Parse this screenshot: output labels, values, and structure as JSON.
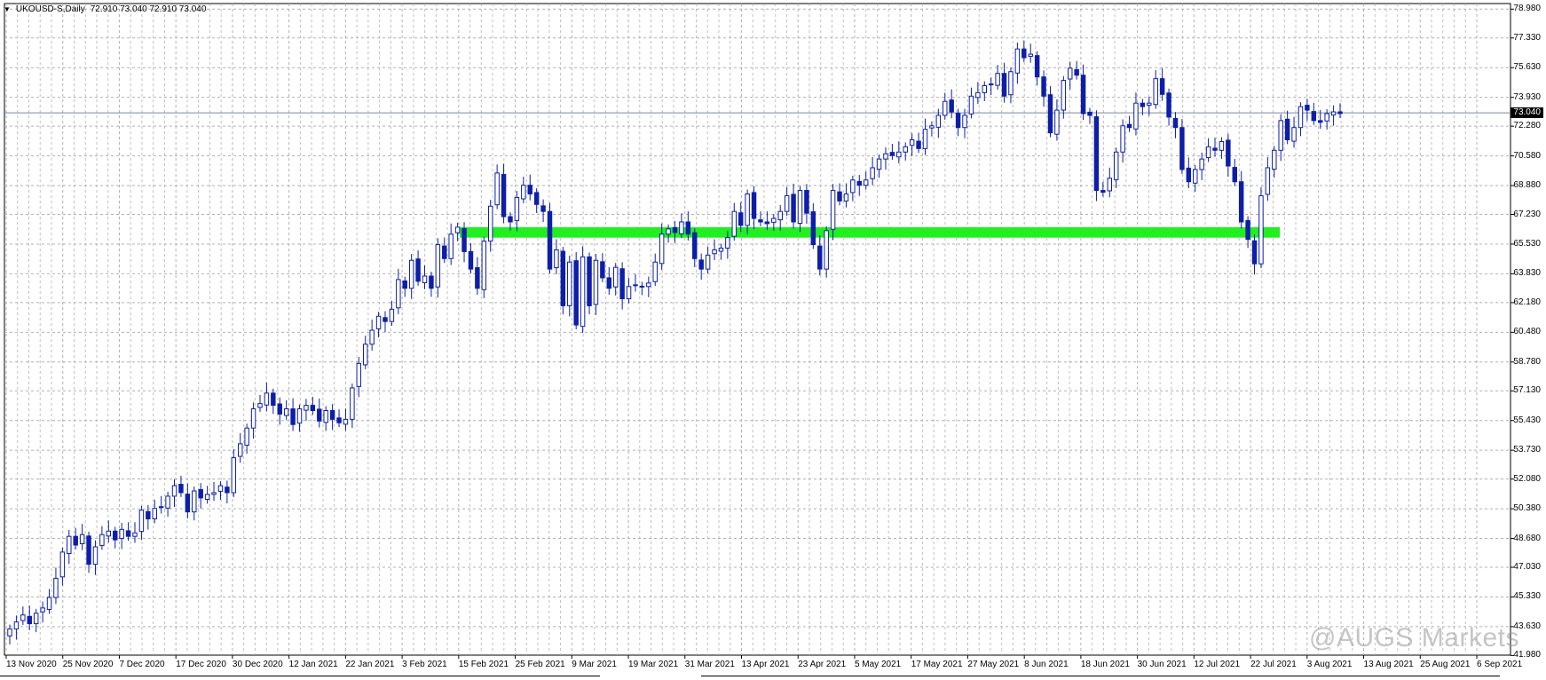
{
  "header": {
    "symbol": "UKOUSD-S,Daily",
    "ohlc": "72.910 73.040 72.910 73.040"
  },
  "watermark": "@AUGS Markets",
  "colors": {
    "up_body": "#ffffff",
    "down_body": "#0d1ea8",
    "candle_line": "#0d1ea8",
    "grid": "#b0b0b0",
    "zone": "#22ee22",
    "price_line": "#7a8a9a",
    "axis": "#000000"
  },
  "chart_data": {
    "type": "candlestick",
    "title": "",
    "xlabel": "",
    "ylabel": "",
    "ylim": [
      42.0,
      79.3
    ],
    "y_ticks": [
      "78.980",
      "77.330",
      "75.630",
      "73.930",
      "72.280",
      "70.580",
      "68.880",
      "67.230",
      "65.530",
      "63.830",
      "62.180",
      "60.480",
      "58.780",
      "57.130",
      "55.430",
      "53.730",
      "52.080",
      "50.380",
      "48.680",
      "47.030",
      "45.330",
      "43.630",
      "41.980"
    ],
    "x_ticks": [
      "13 Nov 2020",
      "25 Nov 2020",
      "7 Dec 2020",
      "17 Dec 2020",
      "30 Dec 2020",
      "12 Jan 2021",
      "22 Jan 2021",
      "3 Feb 2021",
      "15 Feb 2021",
      "25 Feb 2021",
      "9 Mar 2021",
      "19 Mar 2021",
      "31 Mar 2021",
      "13 Apr 2021",
      "23 Apr 2021",
      "5 May 2021",
      "17 May 2021",
      "27 May 2021",
      "8 Jun 2021",
      "18 Jun 2021",
      "30 Jun 2021",
      "12 Jul 2021",
      "22 Jul 2021",
      "3 Aug 2021",
      "13 Aug 2021",
      "25 Aug 2021",
      "6 Sep 2021"
    ],
    "current_price": "73.040",
    "support_zone": [
      65.9,
      66.5
    ],
    "closes": [
      43.5,
      43.9,
      44.3,
      43.8,
      44.4,
      44.7,
      45.3,
      46.4,
      47.9,
      48.8,
      48.3,
      48.9,
      47.2,
      48.2,
      48.9,
      49.1,
      48.6,
      49.2,
      48.8,
      49.0,
      50.3,
      49.8,
      50.4,
      50.5,
      51.1,
      51.7,
      51.3,
      50.2,
      51.4,
      51.0,
      51.2,
      51.3,
      51.7,
      51.3,
      53.3,
      54.1,
      55.0,
      56.1,
      56.4,
      57.0,
      56.3,
      55.8,
      56.1,
      55.2,
      56.1,
      56.3,
      56.0,
      55.4,
      56.0,
      55.5,
      55.3,
      55.5,
      57.3,
      58.7,
      59.8,
      60.6,
      61.4,
      61.1,
      61.8,
      63.5,
      63.0,
      64.6,
      63.4,
      63.7,
      63.0,
      65.5,
      64.7,
      66.1,
      66.5,
      65.1,
      64.1,
      63.0,
      65.7,
      67.7,
      69.6,
      67.1,
      66.8,
      68.2,
      68.9,
      68.4,
      67.8,
      67.4,
      64.1,
      65.2,
      62.0,
      64.5,
      60.9,
      64.8,
      62.0,
      64.6,
      63.6,
      63.0,
      64.2,
      62.4,
      63.1,
      63.2,
      63.1,
      63.3,
      64.5,
      66.1,
      66.4,
      66.2,
      66.8,
      66.1,
      64.7,
      64.1,
      64.9,
      65.2,
      65.3,
      65.9,
      67.4,
      66.6,
      68.4,
      67.0,
      66.8,
      66.7,
      67.0,
      67.4,
      68.3,
      66.8,
      68.6,
      67.3,
      65.5,
      64.1,
      66.3,
      68.6,
      68.0,
      68.4,
      69.2,
      68.9,
      69.2,
      69.9,
      70.4,
      70.7,
      70.6,
      70.8,
      71.1,
      71.5,
      71.0,
      72.1,
      72.3,
      72.9,
      73.7,
      73.1,
      72.2,
      72.9,
      74.0,
      74.2,
      74.6,
      74.7,
      75.3,
      74.0,
      75.4,
      76.7,
      76.2,
      76.4,
      75.1,
      74.0,
      71.9,
      73.2,
      74.9,
      75.6,
      75.2,
      73.0,
      72.9,
      68.6,
      68.5,
      69.3,
      70.8,
      72.3,
      72.2,
      73.6,
      73.4,
      73.6,
      75.0,
      74.1,
      72.8,
      72.2,
      69.8,
      69.1,
      69.8,
      70.4,
      71.1,
      70.9,
      71.4,
      70.0,
      69.1,
      66.8,
      65.8,
      64.4,
      68.3,
      69.9,
      70.9,
      72.6,
      71.5,
      72.2,
      73.4,
      73.2,
      72.6,
      72.5,
      73.0,
      73.1,
      73.0
    ]
  }
}
